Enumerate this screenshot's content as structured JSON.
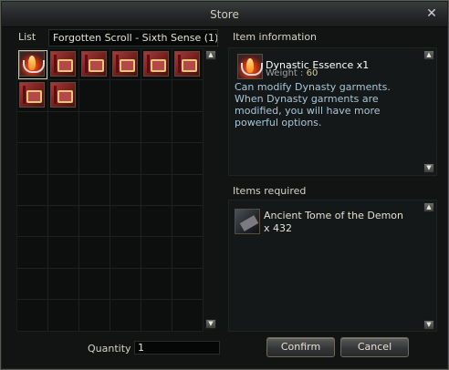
{
  "window": {
    "title": "Store",
    "close_symbol": "✕"
  },
  "list": {
    "label": "List",
    "category": "Forgotten Scroll - Sixth Sense (1)",
    "grid_columns": 6,
    "grid_rows": 9,
    "items": [
      {
        "icon": "dynastic-essence-icon",
        "selected": true
      },
      {
        "icon": "book-icon",
        "selected": false
      },
      {
        "icon": "book-icon",
        "selected": false
      },
      {
        "icon": "book-icon",
        "selected": false
      },
      {
        "icon": "book-icon",
        "selected": false
      },
      {
        "icon": "book-icon",
        "selected": false
      },
      {
        "icon": "book-icon",
        "selected": false
      },
      {
        "icon": "book-icon",
        "selected": false
      }
    ]
  },
  "item_info": {
    "label": "Item information",
    "name": "Dynastic Essence x1",
    "weight_label": "Weight : ",
    "weight_value": "60",
    "description": "Can modify Dynasty garments. When Dynasty garments are modified, you will have more powerful options.",
    "icon": "dynastic-essence-icon"
  },
  "items_required": {
    "label": "Items required",
    "name": "Ancient Tome of the Demon",
    "quantity": "x 432",
    "icon": "tome-icon"
  },
  "scroll": {
    "up": "▲",
    "down": "▼"
  },
  "footer": {
    "quantity_label": "Quantity",
    "quantity_value": "1",
    "confirm_label": "Confirm",
    "cancel_label": "Cancel"
  },
  "colors": {
    "description_text": "#a8c6d8",
    "weight_value": "#d8c898",
    "window_bg": "#121414"
  }
}
